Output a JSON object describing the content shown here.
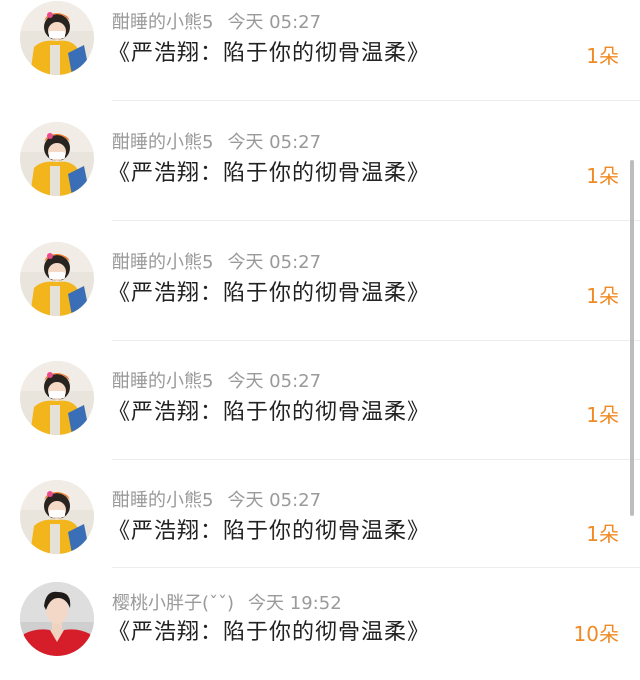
{
  "gift_list": {
    "items": [
      {
        "user": "酣睡的小熊5",
        "time": "今天 05:27",
        "title": "《严浩翔：陷于你的彻骨温柔》",
        "count": "1朵",
        "avatar": "avatar-girl-yellow-coat"
      },
      {
        "user": "酣睡的小熊5",
        "time": "今天 05:27",
        "title": "《严浩翔：陷于你的彻骨温柔》",
        "count": "1朵",
        "avatar": "avatar-girl-yellow-coat"
      },
      {
        "user": "酣睡的小熊5",
        "time": "今天 05:27",
        "title": "《严浩翔：陷于你的彻骨温柔》",
        "count": "1朵",
        "avatar": "avatar-girl-yellow-coat"
      },
      {
        "user": "酣睡的小熊5",
        "time": "今天 05:27",
        "title": "《严浩翔：陷于你的彻骨温柔》",
        "count": "1朵",
        "avatar": "avatar-girl-yellow-coat"
      },
      {
        "user": "酣睡的小熊5",
        "time": "今天 05:27",
        "title": "《严浩翔：陷于你的彻骨温柔》",
        "count": "1朵",
        "avatar": "avatar-girl-yellow-coat"
      },
      {
        "user": "樱桃小胖子(ˇˇ)",
        "time": "今天 19:52",
        "title": "《严浩翔：陷于你的彻骨温柔》",
        "count": "10朵",
        "avatar": "avatar-boy-red-shirt"
      }
    ]
  },
  "colors": {
    "name_gray": "#9a9a9a",
    "title_text": "#222222",
    "count_orange": "#f08a24",
    "divider": "#ededed"
  }
}
